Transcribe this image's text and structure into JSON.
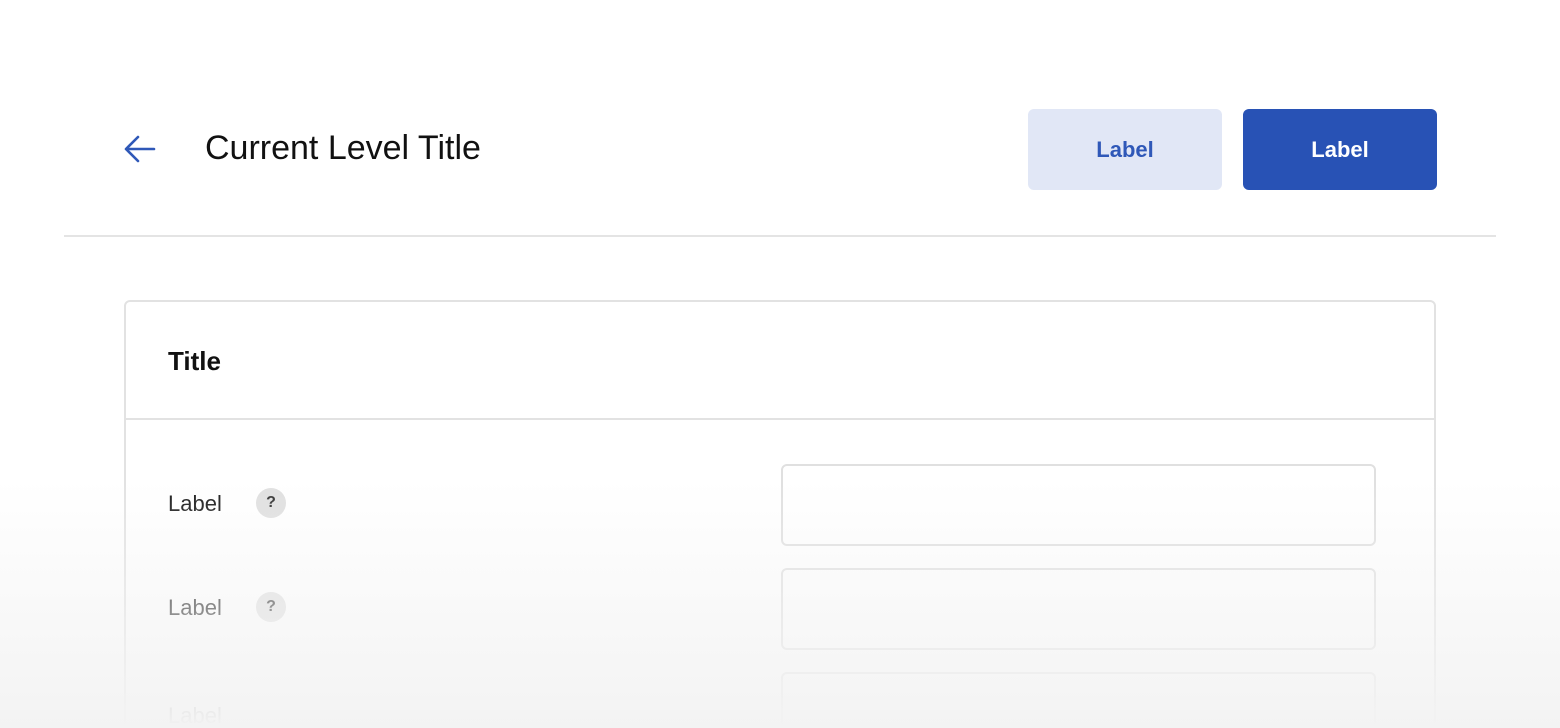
{
  "header": {
    "back_icon": "arrow-left-icon",
    "title": "Current Level Title",
    "secondary_button_label": "Label",
    "primary_button_label": "Label"
  },
  "card": {
    "title": "Title",
    "rows": [
      {
        "label": "Label",
        "help_glyph": "?",
        "value": ""
      },
      {
        "label": "Label",
        "help_glyph": "?",
        "value": ""
      },
      {
        "label": "Label",
        "value": ""
      }
    ]
  },
  "colors": {
    "accent": "#2852b5",
    "accent_light": "#e1e7f6",
    "border": "#e2e2e2"
  }
}
